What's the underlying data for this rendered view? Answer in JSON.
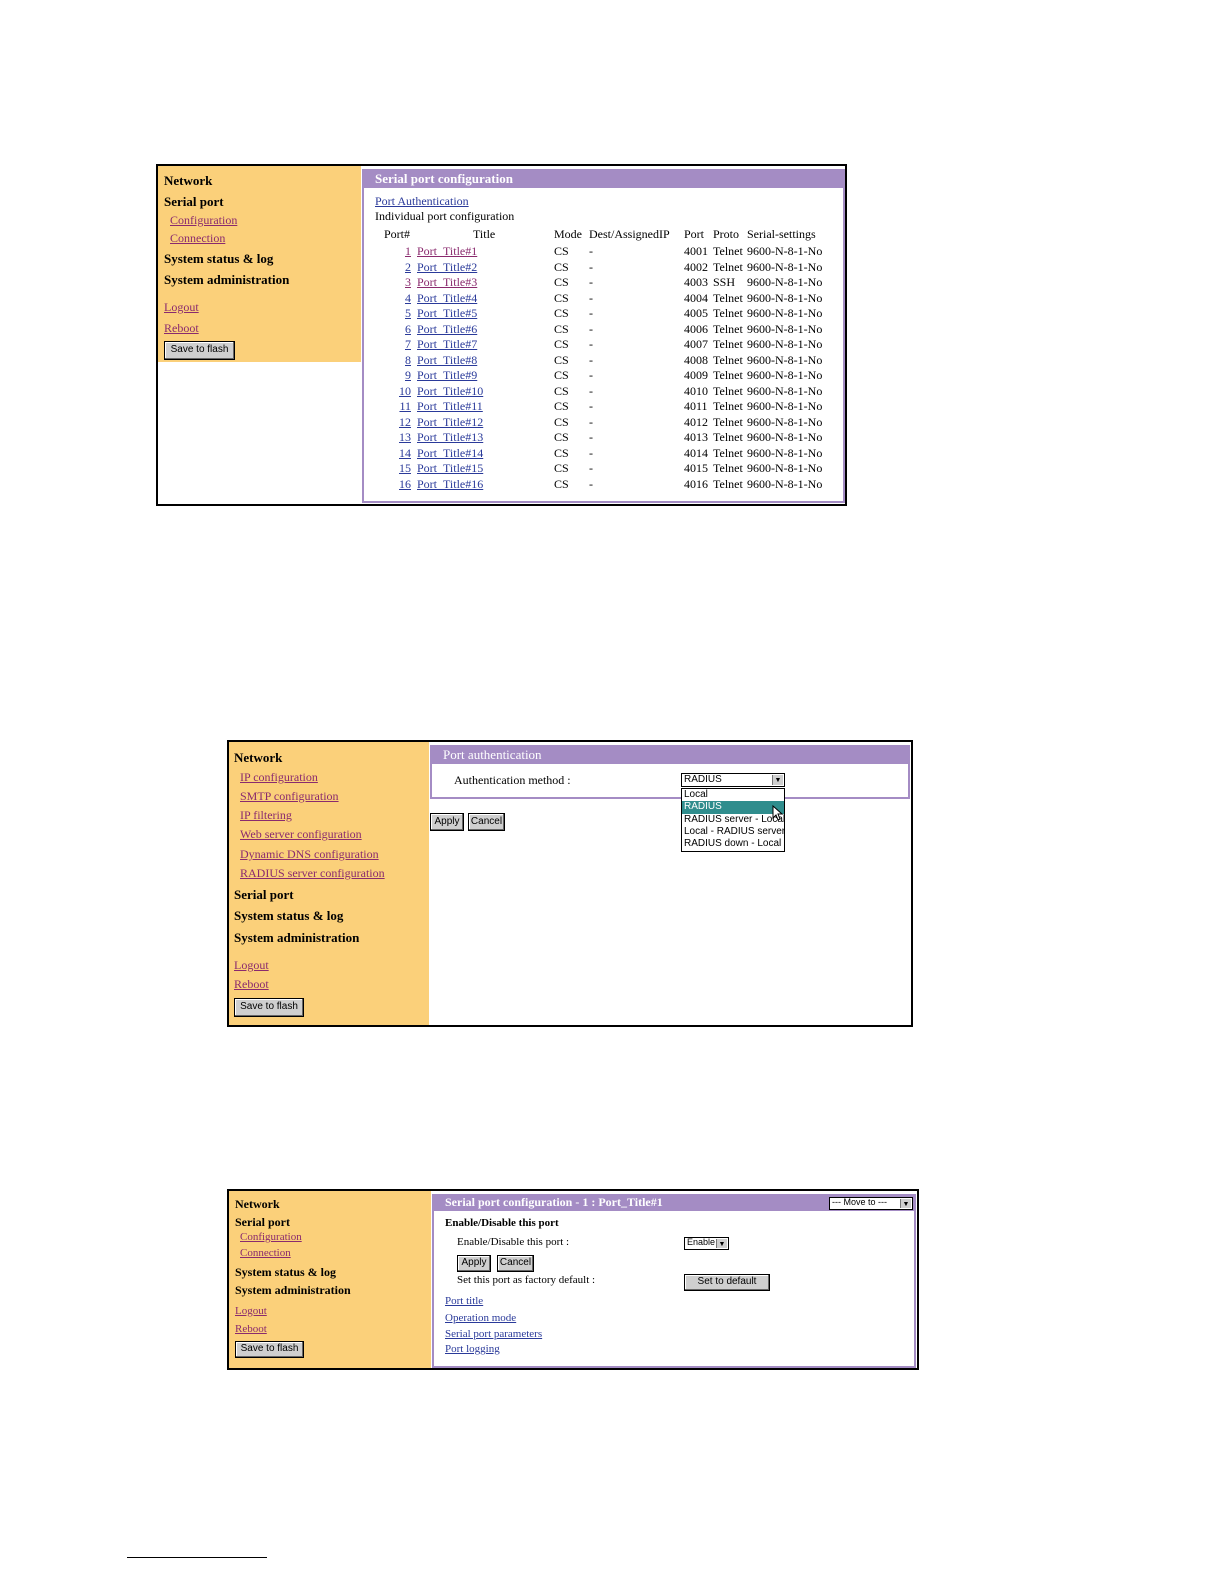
{
  "shot1": {
    "sidebar": {
      "network": "Network",
      "serial_port": "Serial port",
      "configuration": "Configuration",
      "connection": "Connection",
      "system_status": "System status & log",
      "system_admin": "System administration",
      "logout": "Logout",
      "reboot": "Reboot",
      "save": "Save to flash"
    },
    "title": "Serial port configuration",
    "port_auth_link": "Port Authentication",
    "subtitle": "Individual port configuration",
    "headers": [
      "Port#",
      "Title",
      "Mode",
      "Dest/AssignedIP",
      "Port",
      "Proto",
      "Serial-settings"
    ],
    "rows": [
      [
        "1",
        "Port_Title#1",
        "CS",
        "-",
        "4001",
        "Telnet",
        "9600-N-8-1-No"
      ],
      [
        "2",
        "Port_Title#2",
        "CS",
        "-",
        "4002",
        "Telnet",
        "9600-N-8-1-No"
      ],
      [
        "3",
        "Port_Title#3",
        "CS",
        "-",
        "4003",
        "SSH",
        "9600-N-8-1-No"
      ],
      [
        "4",
        "Port_Title#4",
        "CS",
        "-",
        "4004",
        "Telnet",
        "9600-N-8-1-No"
      ],
      [
        "5",
        "Port_Title#5",
        "CS",
        "-",
        "4005",
        "Telnet",
        "9600-N-8-1-No"
      ],
      [
        "6",
        "Port_Title#6",
        "CS",
        "-",
        "4006",
        "Telnet",
        "9600-N-8-1-No"
      ],
      [
        "7",
        "Port_Title#7",
        "CS",
        "-",
        "4007",
        "Telnet",
        "9600-N-8-1-No"
      ],
      [
        "8",
        "Port_Title#8",
        "CS",
        "-",
        "4008",
        "Telnet",
        "9600-N-8-1-No"
      ],
      [
        "9",
        "Port_Title#9",
        "CS",
        "-",
        "4009",
        "Telnet",
        "9600-N-8-1-No"
      ],
      [
        "10",
        "Port_Title#10",
        "CS",
        "-",
        "4010",
        "Telnet",
        "9600-N-8-1-No"
      ],
      [
        "11",
        "Port_Title#11",
        "CS",
        "-",
        "4011",
        "Telnet",
        "9600-N-8-1-No"
      ],
      [
        "12",
        "Port_Title#12",
        "CS",
        "-",
        "4012",
        "Telnet",
        "9600-N-8-1-No"
      ],
      [
        "13",
        "Port_Title#13",
        "CS",
        "-",
        "4013",
        "Telnet",
        "9600-N-8-1-No"
      ],
      [
        "14",
        "Port_Title#14",
        "CS",
        "-",
        "4014",
        "Telnet",
        "9600-N-8-1-No"
      ],
      [
        "15",
        "Port_Title#15",
        "CS",
        "-",
        "4015",
        "Telnet",
        "9600-N-8-1-No"
      ],
      [
        "16",
        "Port_Title#16",
        "CS",
        "-",
        "4016",
        "Telnet",
        "9600-N-8-1-No"
      ]
    ]
  },
  "shot2": {
    "sidebar": {
      "network": "Network",
      "ip_config": "IP configuration",
      "smtp_config": "SMTP configuration",
      "ip_filtering": "IP filtering",
      "web_server": "Web server configuration",
      "ddns": "Dynamic DNS configuration",
      "radius_config": "RADIUS server configuration",
      "serial_port": "Serial port",
      "system_status": "System status & log",
      "system_admin": "System administration",
      "logout": "Logout",
      "reboot": "Reboot",
      "save": "Save to flash"
    },
    "title": "Port authentication",
    "auth_label": "Authentication method :",
    "auth_selected": "RADIUS",
    "auth_options": [
      "Local",
      "RADIUS",
      "RADIUS server - Local",
      "Local - RADIUS server",
      "RADIUS down - Local"
    ],
    "apply": "Apply",
    "cancel": "Cancel"
  },
  "shot3": {
    "sidebar": {
      "network": "Network",
      "serial_port": "Serial port",
      "configuration": "Configuration",
      "connection": "Connection",
      "system_status": "System status & log",
      "system_admin": "System administration",
      "logout": "Logout",
      "reboot": "Reboot",
      "save": "Save to flash"
    },
    "title": "Serial port configuration - 1 : Port_Title#1",
    "move_to": "--- Move to ---",
    "section": "Enable/Disable this port",
    "enable_label": "Enable/Disable this port :",
    "enable_value": "Enable",
    "apply": "Apply",
    "cancel": "Cancel",
    "factory_label": "Set this port as factory default :",
    "set_default": "Set to default",
    "links": [
      "Port title",
      "Operation mode",
      "Serial port parameters",
      "Port logging"
    ]
  }
}
